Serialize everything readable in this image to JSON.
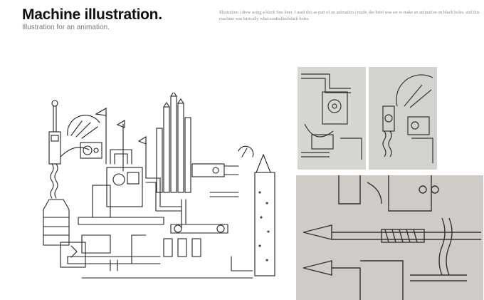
{
  "header": {
    "title": "Machine illustration.",
    "subtitle": "Illustration for an animation."
  },
  "description": "Illustration i drew using a black fine liner, I used this as part of an animation i made, the brief was set to make an animation on black holes, and this machine was basically what controlled black holes.",
  "images": [
    {
      "name": "machine-drawing",
      "kind": "ink line drawing of a machine"
    },
    {
      "name": "detail-photo-1",
      "kind": "photo close-up of drawing"
    },
    {
      "name": "detail-photo-2",
      "kind": "photo close-up of drawing"
    },
    {
      "name": "detail-photo-3",
      "kind": "photo close-up of drawing"
    }
  ]
}
